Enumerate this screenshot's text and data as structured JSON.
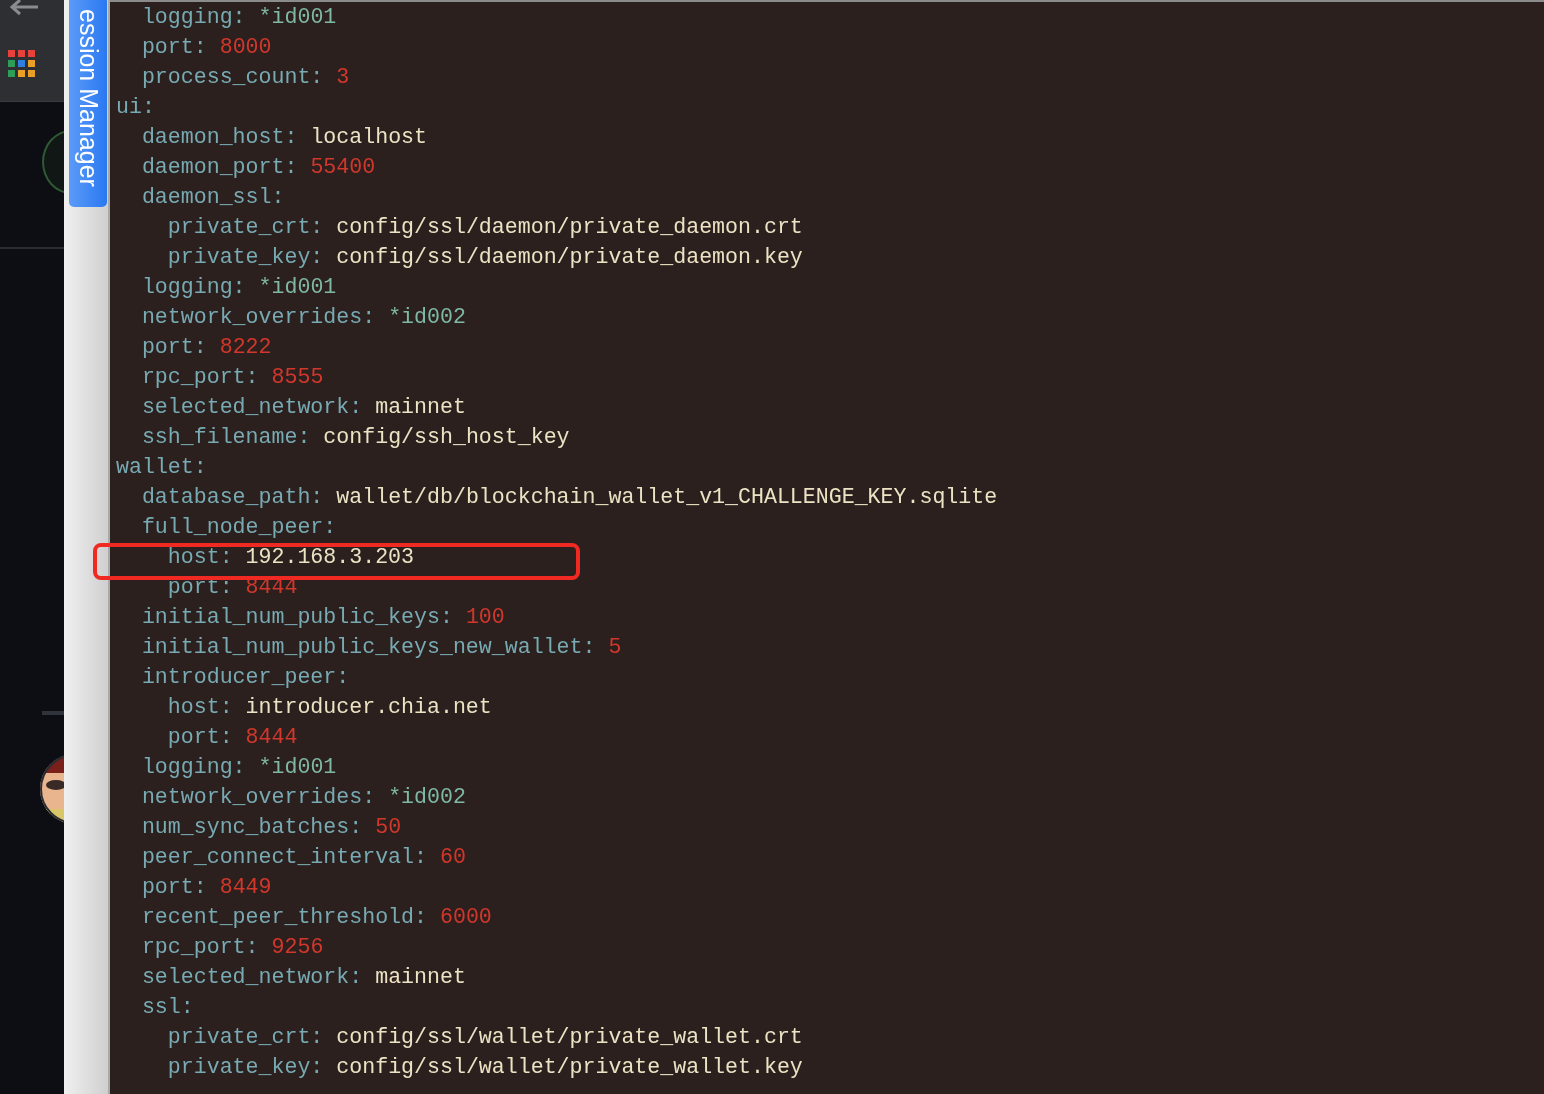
{
  "side_tab": {
    "label": "ession Manager"
  },
  "yaml": [
    {
      "children": [
        {
          "key": "logging:",
          "value": "*id001",
          "kind": "alias"
        },
        {
          "key": "port:",
          "value": "8000",
          "kind": "number"
        },
        {
          "key": "process_count:",
          "value": "3",
          "kind": "number"
        }
      ]
    },
    {
      "key": "ui:",
      "children": [
        {
          "key": "daemon_host:",
          "value": "localhost",
          "kind": "string"
        },
        {
          "key": "daemon_port:",
          "value": "55400",
          "kind": "number"
        },
        {
          "key": "daemon_ssl:",
          "children": [
            {
              "key": "private_crt:",
              "value": "config/ssl/daemon/private_daemon.crt",
              "kind": "string"
            },
            {
              "key": "private_key:",
              "value": "config/ssl/daemon/private_daemon.key",
              "kind": "string"
            }
          ]
        },
        {
          "key": "logging:",
          "value": "*id001",
          "kind": "alias"
        },
        {
          "key": "network_overrides:",
          "value": "*id002",
          "kind": "alias"
        },
        {
          "key": "port:",
          "value": "8222",
          "kind": "number"
        },
        {
          "key": "rpc_port:",
          "value": "8555",
          "kind": "number"
        },
        {
          "key": "selected_network:",
          "value": "mainnet",
          "kind": "string"
        },
        {
          "key": "ssh_filename:",
          "value": "config/ssh_host_key",
          "kind": "string"
        }
      ]
    },
    {
      "key": "wallet:",
      "children": [
        {
          "key": "database_path:",
          "value": "wallet/db/blockchain_wallet_v1_CHALLENGE_KEY.sqlite",
          "kind": "string"
        },
        {
          "key": "full_node_peer:",
          "children": [
            {
              "key": "host:",
              "value": "192.168.3.203",
              "kind": "string"
            },
            {
              "key": "port:",
              "value": "8444",
              "kind": "number"
            }
          ]
        },
        {
          "key": "initial_num_public_keys:",
          "value": "100",
          "kind": "number"
        },
        {
          "key": "initial_num_public_keys_new_wallet:",
          "value": "5",
          "kind": "number"
        },
        {
          "key": "introducer_peer:",
          "children": [
            {
              "key": "host:",
              "value": "introducer.chia.net",
              "kind": "string"
            },
            {
              "key": "port:",
              "value": "8444",
              "kind": "number"
            }
          ]
        },
        {
          "key": "logging:",
          "value": "*id001",
          "kind": "alias"
        },
        {
          "key": "network_overrides:",
          "value": "*id002",
          "kind": "alias"
        },
        {
          "key": "num_sync_batches:",
          "value": "50",
          "kind": "number"
        },
        {
          "key": "peer_connect_interval:",
          "value": "60",
          "kind": "number"
        },
        {
          "key": "port:",
          "value": "8449",
          "kind": "number"
        },
        {
          "key": "recent_peer_threshold:",
          "value": "6000",
          "kind": "number"
        },
        {
          "key": "rpc_port:",
          "value": "9256",
          "kind": "number"
        },
        {
          "key": "selected_network:",
          "value": "mainnet",
          "kind": "string"
        },
        {
          "key": "ssl:",
          "children": [
            {
              "key": "private_crt:",
              "value": "config/ssl/wallet/private_wallet.crt",
              "kind": "string"
            },
            {
              "key": "private_key:",
              "value": "config/ssl/wallet/private_wallet.key",
              "kind": "string"
            }
          ]
        }
      ]
    }
  ]
}
